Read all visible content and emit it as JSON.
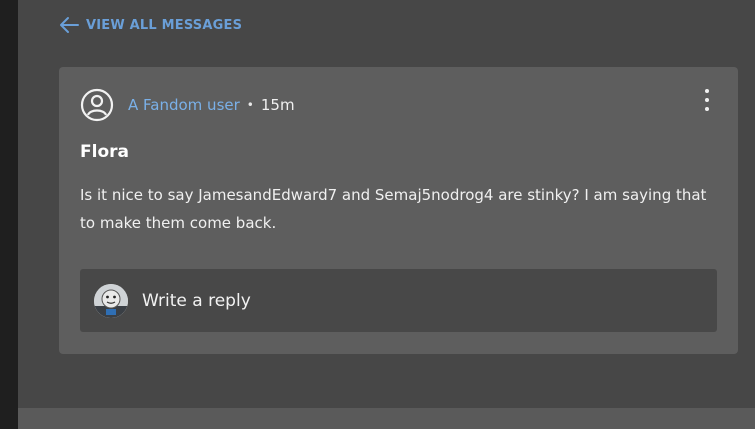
{
  "nav": {
    "back_label": "VIEW ALL MESSAGES",
    "back_icon": "arrow-left-icon"
  },
  "post": {
    "author": "A Fandom user",
    "separator": "•",
    "time_ago": "15m",
    "title": "Flora",
    "body": "Is it nice to say JamesandEdward7 and Semaj5nodrog4 are stinky? I am saying that to make them come back.",
    "author_icon": "user-circle-icon",
    "menu_icon": "more-vertical-icon"
  },
  "reply": {
    "placeholder": "Write a reply",
    "avatar_icon": "avatar-thomas-icon"
  },
  "colors": {
    "accent": "#6a9fd8",
    "author": "#7ab0e8",
    "card": "#5e5e5e",
    "background": "#474747",
    "reply_box": "#484848"
  }
}
